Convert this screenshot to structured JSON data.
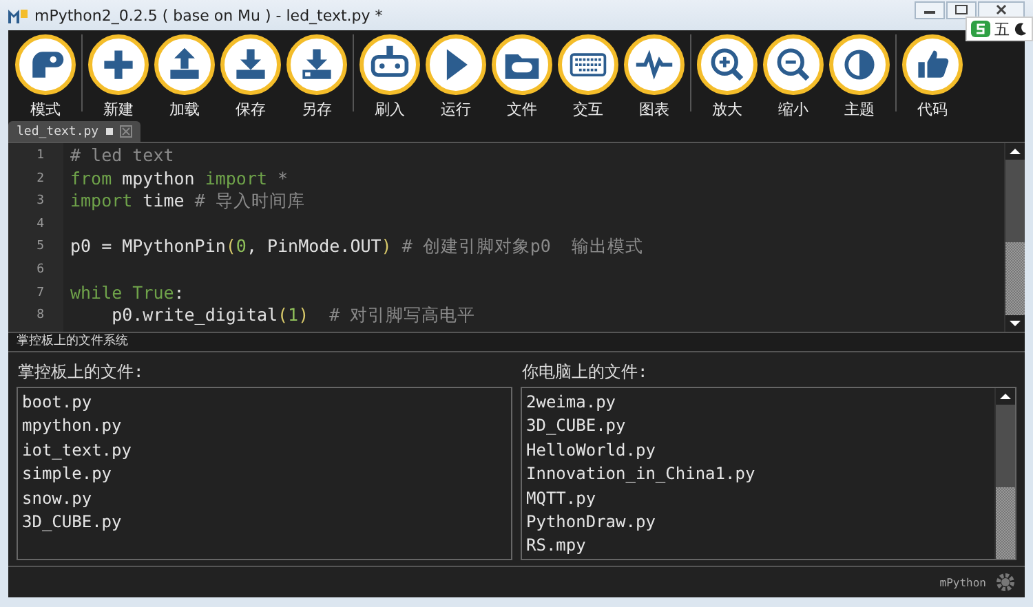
{
  "window": {
    "title": "mPython2_0.2.5 ( base on Mu ) - led_text.py *"
  },
  "ime_bar": {
    "mode": "五"
  },
  "toolbar": [
    {
      "buttons": [
        {
          "label": "模式"
        }
      ]
    },
    {
      "buttons": [
        {
          "label": "新建"
        },
        {
          "label": "加载"
        },
        {
          "label": "保存"
        },
        {
          "label": "另存"
        }
      ]
    },
    {
      "buttons": [
        {
          "label": "刷入"
        },
        {
          "label": "运行"
        },
        {
          "label": "文件"
        },
        {
          "label": "交互"
        },
        {
          "label": "图表"
        }
      ]
    },
    {
      "buttons": [
        {
          "label": "放大"
        },
        {
          "label": "缩小"
        },
        {
          "label": "主题"
        }
      ]
    },
    {
      "buttons": [
        {
          "label": "代码"
        }
      ]
    }
  ],
  "tabs": [
    {
      "label": "led_text.py",
      "modified": true,
      "selected": true
    }
  ],
  "editor": {
    "lines": [
      {
        "number": "1",
        "tokens": [
          {
            "text": "# led text",
            "kind": "comment"
          }
        ]
      },
      {
        "number": "2",
        "tokens": [
          {
            "text": "from",
            "kind": "keyword"
          },
          {
            "text": " mpython ",
            "kind": "plain"
          },
          {
            "text": "import",
            "kind": "keyword"
          },
          {
            "text": " *",
            "kind": "comment"
          }
        ]
      },
      {
        "number": "3",
        "tokens": [
          {
            "text": "import",
            "kind": "keyword"
          },
          {
            "text": " time ",
            "kind": "plain"
          },
          {
            "text": "# 导入时间库",
            "kind": "comment"
          }
        ]
      },
      {
        "number": "4"
      },
      {
        "number": "5",
        "tokens": [
          {
            "text": "p0 = MPythonPin",
            "kind": "plain"
          },
          {
            "text": "(",
            "kind": "paren"
          },
          {
            "text": "0",
            "kind": "number"
          },
          {
            "text": ", PinMode.OUT",
            "kind": "plain"
          },
          {
            "text": ")",
            "kind": "paren"
          },
          {
            "text": " # 创建引脚对象p0  输出模式",
            "kind": "comment"
          }
        ]
      },
      {
        "number": "6"
      },
      {
        "number": "7",
        "tokens": [
          {
            "text": "while",
            "kind": "keyword"
          },
          {
            "text": " True",
            "kind": "keyword"
          },
          {
            "text": ":",
            "kind": "plain"
          }
        ]
      },
      {
        "number": "8",
        "tokens": [
          {
            "text": "    p0.write_digital",
            "kind": "plain"
          },
          {
            "text": "(",
            "kind": "paren"
          },
          {
            "text": "1",
            "kind": "number"
          },
          {
            "text": ")",
            "kind": "paren"
          },
          {
            "text": "  # 对引脚写高电平",
            "kind": "comment"
          }
        ]
      }
    ]
  },
  "files_pane": {
    "title": "掌控板上的文件系统",
    "device": {
      "label": "掌控板上的文件:",
      "files": [
        "boot.py",
        "mpython.py",
        "iot_text.py",
        "simple.py",
        "snow.py",
        "3D_CUBE.py"
      ]
    },
    "computer": {
      "label": "你电脑上的文件:",
      "files": [
        "2weima.py",
        "3D_CUBE.py",
        "HelloWorld.py",
        "Innovation_in_China1.py",
        "MQTT.py",
        "PythonDraw.py",
        "RS.mpy"
      ]
    }
  },
  "status_bar": {
    "mode": "mPython"
  }
}
